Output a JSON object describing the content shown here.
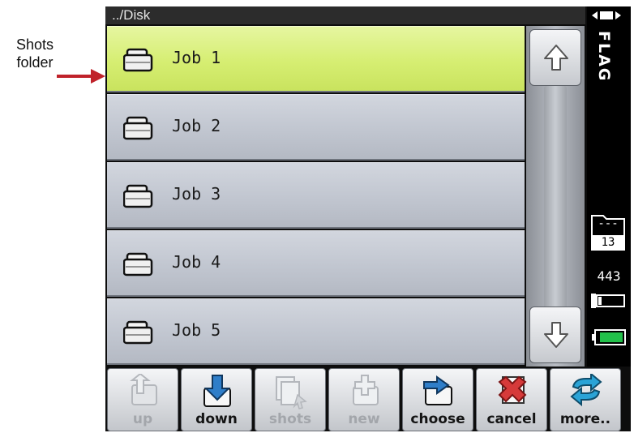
{
  "callout": {
    "text": "Shots folder"
  },
  "path": "../Disk",
  "items": [
    {
      "label": "Job 1",
      "selected": true
    },
    {
      "label": "Job 2",
      "selected": false
    },
    {
      "label": "Job 3",
      "selected": false
    },
    {
      "label": "Job 4",
      "selected": false
    },
    {
      "label": "Job 5",
      "selected": false
    }
  ],
  "side": {
    "flag": "FLAG",
    "folder_dash": "---",
    "folder_count": "13",
    "shot_count": "443"
  },
  "toolbar": {
    "up": "up",
    "down": "down",
    "shots": "shots",
    "new": "new",
    "choose": "choose",
    "cancel": "cancel",
    "more": "more.."
  },
  "colors": {
    "selected_row": "#d6ee72",
    "annotation_arrow": "#c0222a",
    "battery": "#22c04a",
    "cancel_x": "#d63a3a",
    "down_arrow": "#2f7ec9",
    "more_arrows": "#2aa3d6"
  },
  "icons": [
    "up-arrow-icon",
    "down-arrow-icon",
    "folder-icon",
    "battery-icon"
  ]
}
